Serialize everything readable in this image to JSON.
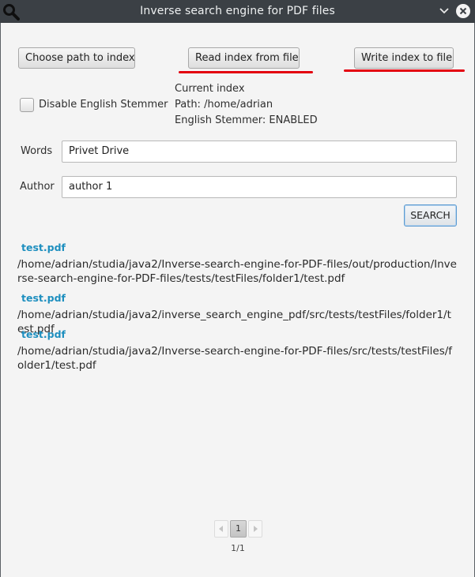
{
  "window": {
    "title": "Inverse search engine for PDF files"
  },
  "toolbar": {
    "choose_path_label": "Choose path to index",
    "read_index_label": "Read index from file",
    "write_index_label": "Write index to file"
  },
  "options": {
    "disable_stemmer_label": "Disable English Stemmer",
    "disable_stemmer_checked": false
  },
  "index_info": {
    "heading": "Current index",
    "path": "Path: /home/adrian",
    "stemmer": "English Stemmer: ENABLED"
  },
  "search": {
    "words_label": "Words",
    "words_value": "Privet Drive",
    "author_label": "Author",
    "author_value": "author 1",
    "button_label": "SEARCH"
  },
  "results": [
    {
      "name": "test.pdf",
      "path": "/home/adrian/studia/java2/Inverse-search-engine-for-PDF-files/out/production/Inverse-search-engine-for-PDF-files/tests/testFiles/folder1/test.pdf"
    },
    {
      "name": "test.pdf",
      "path": "/home/adrian/studia/java2/inverse_search_engine_pdf/src/tests/testFiles/folder1/test.pdf"
    },
    {
      "name": "test.pdf",
      "path": "/home/adrian/studia/java2/Inverse-search-engine-for-PDF-files/src/tests/testFiles/folder1/test.pdf"
    }
  ],
  "pagination": {
    "current_page": "1",
    "info": "1/1"
  },
  "icons": {
    "app": "magnifier-icon",
    "minimize": "chevron-down-icon",
    "close": "close-icon",
    "prev": "triangle-left-icon",
    "next": "triangle-right-icon"
  },
  "colors": {
    "titlebar": "#3b4045",
    "link": "#1e8fbf",
    "annotation": "#e3000f",
    "focus": "#5c9bd1"
  }
}
